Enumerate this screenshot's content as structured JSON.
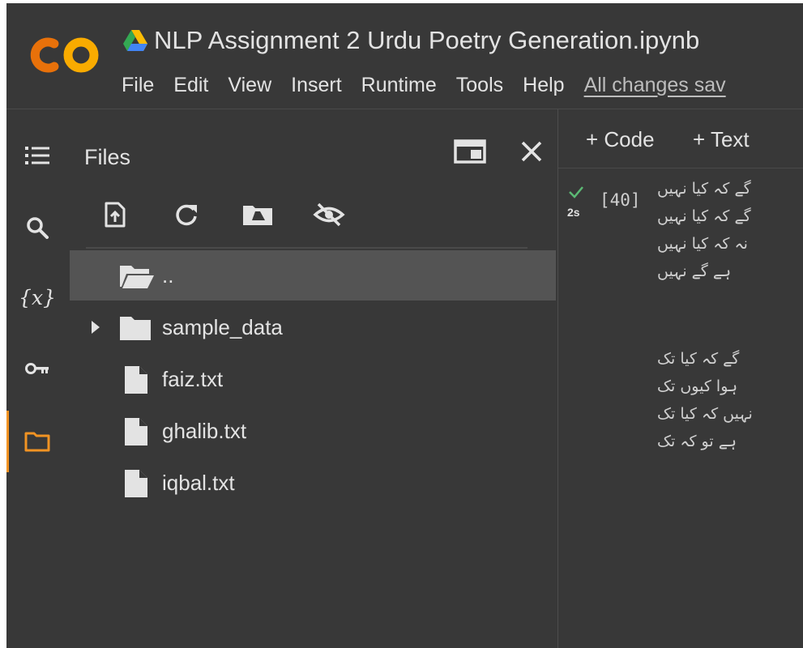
{
  "header": {
    "logo_text": "CO",
    "notebook_title": "NLP Assignment 2 Urdu Poetry Generation.ipynb",
    "menu": [
      "File",
      "Edit",
      "View",
      "Insert",
      "Runtime",
      "Tools",
      "Help"
    ],
    "save_status": "All changes sav"
  },
  "rail": {
    "items": [
      {
        "name": "table-of-contents",
        "icon": "list-icon"
      },
      {
        "name": "find",
        "icon": "search-icon"
      },
      {
        "name": "variables",
        "icon": "variables-icon",
        "label": "{x}"
      },
      {
        "name": "secrets",
        "icon": "key-icon"
      },
      {
        "name": "files",
        "icon": "folder-icon",
        "active": true
      }
    ],
    "active_color": "#f19323"
  },
  "files_panel": {
    "title": "Files",
    "toolbar": [
      "upload-icon",
      "refresh-icon",
      "mount-drive-icon",
      "hide-icon"
    ],
    "items": [
      {
        "name": "..",
        "type": "folder-open",
        "selected": true
      },
      {
        "name": "sample_data",
        "type": "folder",
        "expandable": true
      },
      {
        "name": "faiz.txt",
        "type": "file"
      },
      {
        "name": "ghalib.txt",
        "type": "file"
      },
      {
        "name": "iqbal.txt",
        "type": "file"
      }
    ]
  },
  "notebook": {
    "add_code_label": "+ Code",
    "add_text_label": "+ Text",
    "cell": {
      "status": "success",
      "run_time": "2s",
      "execution_count": "[40]",
      "output_block_1": [
        "گے کہ کیا نہیں",
        "گے کہ کیا نہیں",
        "نہ کہ کیا نہیں",
        "ہے گے نہیں"
      ],
      "output_block_2": [
        "گے کہ کیا تک",
        "ہوا کیوں تک",
        "نہیں کہ کیا تک",
        "ہے تو کہ تک"
      ]
    }
  },
  "colors": {
    "background": "#383838",
    "selected_row": "#545454",
    "success_check": "#5bb974",
    "logo_orange": "#f9ab00",
    "logo_dark_orange": "#e8710a"
  }
}
